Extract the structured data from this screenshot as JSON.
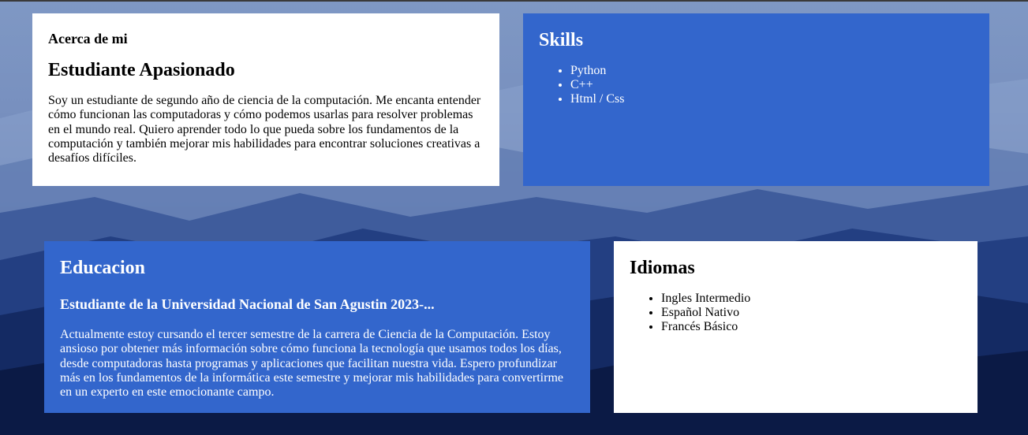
{
  "about": {
    "heading": "Acerca de mi",
    "title": "Estudiante Apasionado",
    "text": "Soy un estudiante de segundo año de ciencia de la computación. Me encanta entender cómo funcionan las computadoras y cómo podemos usarlas para resolver problemas en el mundo real. Quiero aprender todo lo que pueda sobre los fundamentos de la computación y también mejorar mis habilidades para encontrar soluciones creativas a desafíos difíciles."
  },
  "skills": {
    "title": "Skills",
    "items": [
      "Python",
      "C++",
      "Html / Css"
    ]
  },
  "education": {
    "title": "Educacion",
    "subtitle": "Estudiante de la Universidad Nacional de San Agustin 2023-...",
    "text": "Actualmente estoy cursando el tercer semestre de la carrera de Ciencia de la Computación. Estoy ansioso por obtener más información sobre cómo funciona la tecnología que usamos todos los días, desde computadoras hasta programas y aplicaciones que facilitan nuestra vida. Espero profundizar más en los fundamentos de la informática este semestre y mejorar mis habilidades para convertirme en un experto en este emocionante campo."
  },
  "languages": {
    "title": "Idiomas",
    "items": [
      "Ingles Intermedio",
      "Español Nativo",
      "Francés Básico"
    ]
  },
  "colors": {
    "card_blue": "#3366cc",
    "card_white": "#ffffff"
  }
}
